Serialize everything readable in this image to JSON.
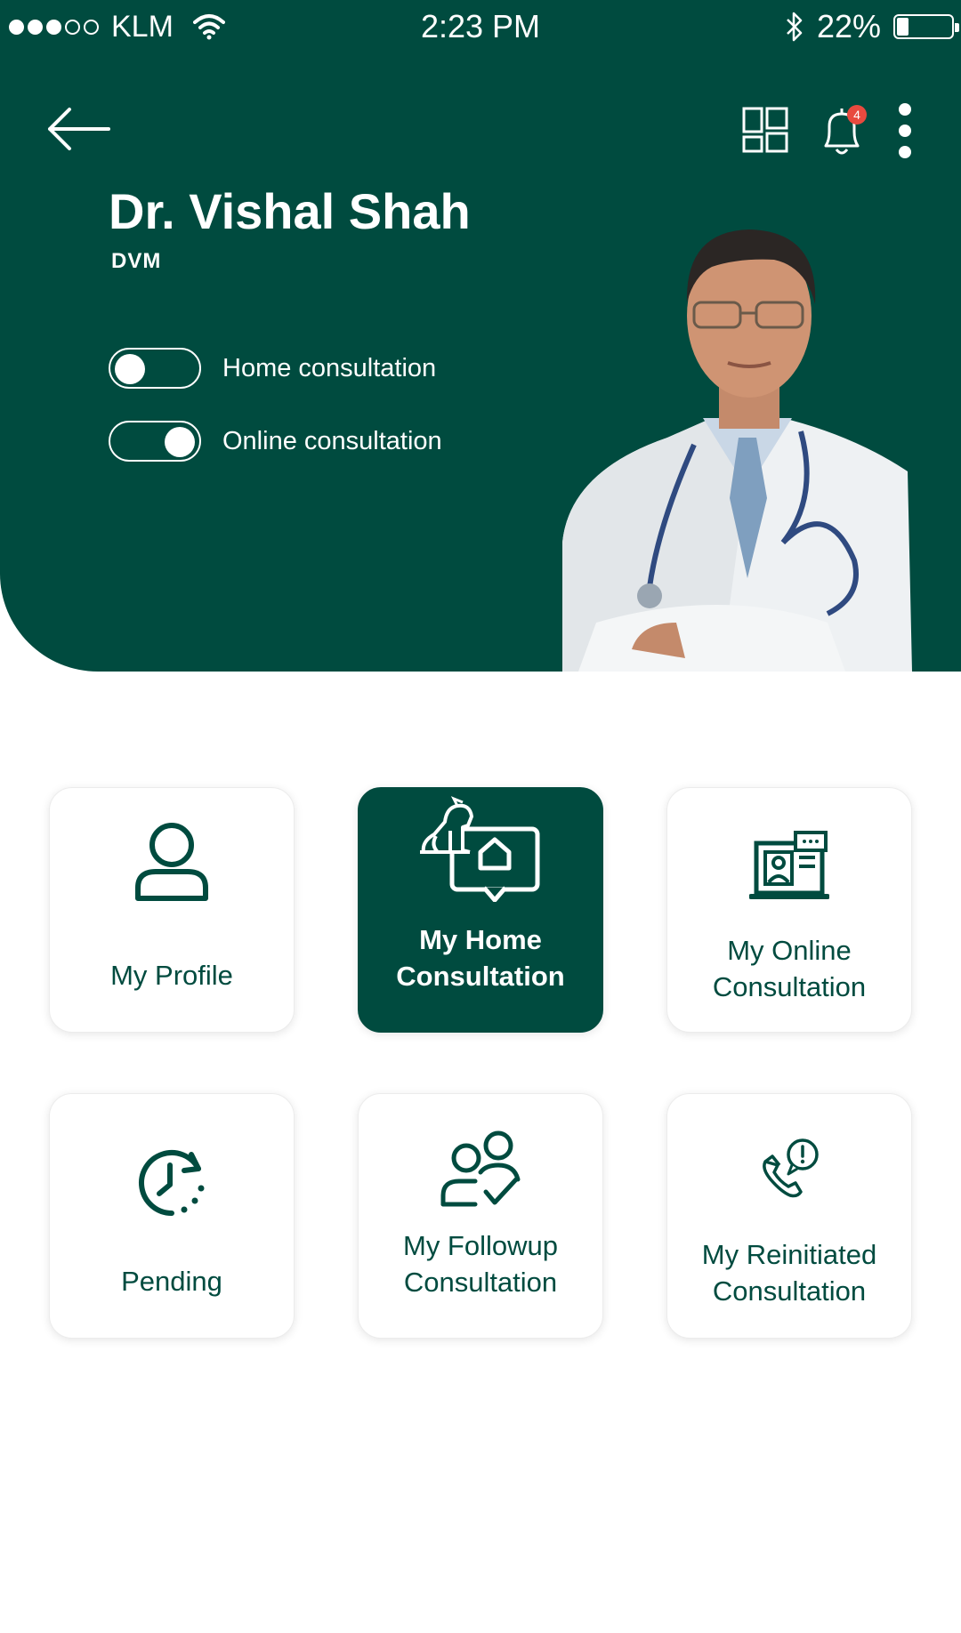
{
  "status_bar": {
    "carrier": "KLM",
    "time": "2:23 PM",
    "battery_percent": "22%",
    "battery_level": 0.22,
    "signal_bars_filled": 3,
    "signal_bars_total": 5,
    "icons": [
      "wifi-icon",
      "bluetooth-icon",
      "battery-icon"
    ]
  },
  "header": {
    "doctor_name": "Dr. Vishal Shah",
    "degree": "DVM",
    "notification_count": "4",
    "icons": [
      "back-arrow-icon",
      "dashboard-icon",
      "bell-icon",
      "more-vertical-icon"
    ],
    "toggles": [
      {
        "label": "Home consultation",
        "on": false
      },
      {
        "label": "Online consultation",
        "on": true
      }
    ]
  },
  "tiles": [
    {
      "label_line1": "My Profile",
      "label_line2": "",
      "icon": "user-icon",
      "active": false
    },
    {
      "label_line1": "My Home",
      "label_line2": "Consultation",
      "icon": "pet-home-consultation-icon",
      "active": true
    },
    {
      "label_line1": "My Online",
      "label_line2": "Consultation",
      "icon": "online-consultation-icon",
      "active": false
    },
    {
      "label_line1": "Pending",
      "label_line2": "",
      "icon": "clock-pending-icon",
      "active": false
    },
    {
      "label_line1": "My Followup",
      "label_line2": "Consultation",
      "icon": "followup-users-icon",
      "active": false
    },
    {
      "label_line1": "My Reinitiated",
      "label_line2": "Consultation",
      "icon": "phone-alert-icon",
      "active": false
    }
  ],
  "colors": {
    "primary": "#004b3f",
    "background": "#ffffff",
    "badge": "#e84a3f"
  }
}
